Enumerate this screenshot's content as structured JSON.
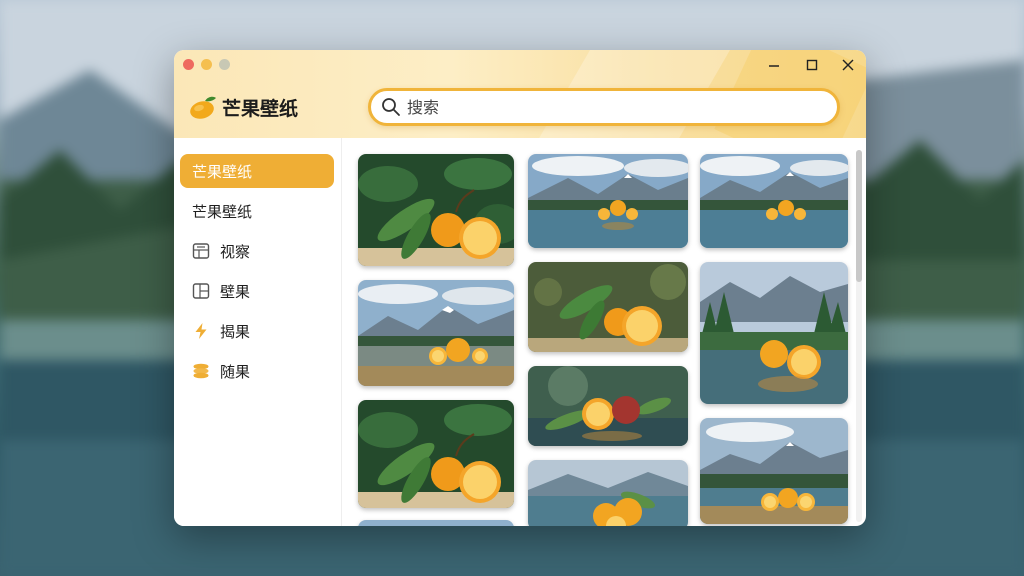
{
  "app": {
    "title": "芒果壁纸",
    "accent_color": "#efae35"
  },
  "search": {
    "placeholder": "搜索",
    "value": ""
  },
  "window_controls": {
    "minimize_icon": "minimize-icon",
    "maximize_icon": "maximize-icon",
    "close_icon": "close-icon"
  },
  "sidebar": {
    "items": [
      {
        "label": "芒果壁纸",
        "icon": "",
        "active": true
      },
      {
        "label": "芒果壁纸",
        "icon": "",
        "active": false
      },
      {
        "label": "视察",
        "icon": "grid-icon",
        "active": false
      },
      {
        "label": "壁果",
        "icon": "layout-icon",
        "active": false
      },
      {
        "label": "揭果",
        "icon": "lightning-icon",
        "active": false
      },
      {
        "label": "随果",
        "icon": "layers-icon",
        "active": false
      }
    ]
  },
  "gallery": {
    "thumbnails": [
      {
        "subject": "orange-leaves"
      },
      {
        "subject": "mountain-lake-oranges"
      },
      {
        "subject": "orange-leaves"
      },
      {
        "subject": "mountain-lake-oranges"
      },
      {
        "subject": "orange-leaves"
      },
      {
        "subject": "oranges-water"
      },
      {
        "subject": "mountain-lake-oranges"
      },
      {
        "subject": "mountain-lake-oranges"
      },
      {
        "subject": "forest-lake-oranges"
      },
      {
        "subject": "mountain-lake-oranges"
      },
      {
        "subject": "mountain-lake-oranges"
      }
    ]
  },
  "scrollbar": {
    "position": 0.0
  }
}
